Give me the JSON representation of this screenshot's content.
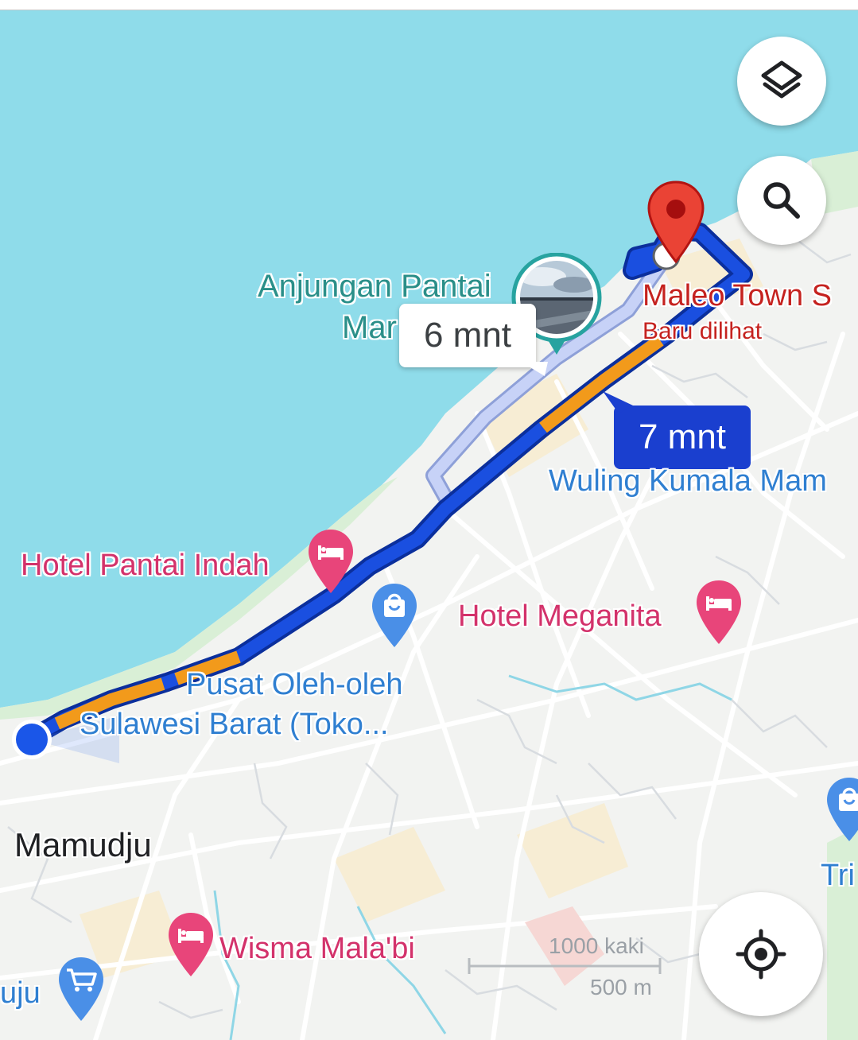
{
  "route": {
    "duration_alt": "6 mnt",
    "duration_main": "7 mnt"
  },
  "places": {
    "anjungan_line1": "Anjungan Pantai",
    "anjungan_line2": "Mar",
    "maleo_name": "Maleo Town S",
    "maleo_sub": "Baru dilihat",
    "wuling": "Wuling Kumala Mam",
    "hotel_pantai": "Hotel Pantai Indah",
    "hotel_meganita": "Hotel Meganita",
    "pusat_line1": "Pusat Oleh-oleh",
    "pusat_line2": "Sulawesi Barat (Toko...",
    "mamudju": "Mamudju",
    "wisma": "Wisma Mala'bi",
    "uju_partial": "uju",
    "tri_partial": "Tri"
  },
  "scale": {
    "feet": "1000 kaki",
    "meters": "500 m"
  },
  "icons": {
    "layers": "layers-icon",
    "search": "search-icon",
    "location": "my-location-icon",
    "destination": "destination-pin-icon",
    "hotel": "hotel-icon",
    "shopping": "shopping-bag-icon",
    "cart": "shopping-cart-icon"
  },
  "colors": {
    "water": "#8fdcea",
    "land": "#f2f3f1",
    "route_blue": "#1a4fe0",
    "route_traffic": "#f29a1b",
    "route_alt": "#c2cdf7",
    "pin_red": "#ea4335",
    "hotel_pink": "#e8457a",
    "shop_blue": "#4a8fe7"
  }
}
